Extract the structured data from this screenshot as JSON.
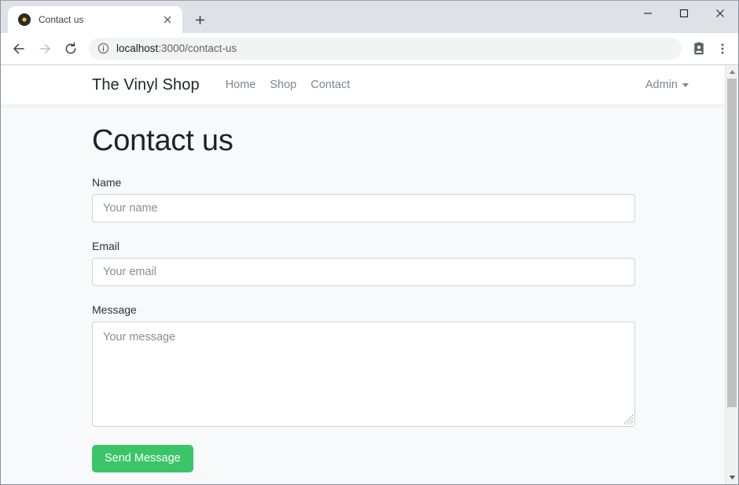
{
  "browser": {
    "tab": {
      "title": "Contact us",
      "favicon": "vinyl-record-icon",
      "close_icon": "close-icon"
    },
    "new_tab_icon": "plus-icon",
    "window_controls": {
      "minimize": "minimize-icon",
      "maximize": "maximize-icon",
      "close": "close-icon"
    },
    "toolbar": {
      "back_icon": "back-arrow-icon",
      "forward_icon": "forward-arrow-icon",
      "reload_icon": "reload-icon",
      "site_info_icon": "info-circle-icon",
      "url_host": "localhost",
      "url_path": ":3000/contact-us",
      "url_full": "localhost:3000/contact-us",
      "profile_icon": "account-card-icon",
      "menu_icon": "three-dot-menu-icon"
    },
    "scrollbar": {
      "up_icon": "scroll-up-arrow-icon",
      "down_icon": "scroll-down-arrow-icon"
    }
  },
  "site": {
    "brand": "The Vinyl Shop",
    "nav_links": [
      {
        "label": "Home"
      },
      {
        "label": "Shop"
      },
      {
        "label": "Contact"
      }
    ],
    "account": {
      "label": "Admin",
      "caret_icon": "chevron-down-icon"
    }
  },
  "main": {
    "page_title": "Contact us",
    "form": {
      "fields": [
        {
          "label": "Name",
          "placeholder": "Your name",
          "value": ""
        },
        {
          "label": "Email",
          "placeholder": "Your email",
          "value": ""
        },
        {
          "label": "Message",
          "placeholder": "Your message",
          "value": ""
        }
      ],
      "submit_label": "Send Message"
    }
  },
  "colors": {
    "accent_green": "#3ac569",
    "page_background": "#f8f9fb",
    "navbar_background": "#ffffff",
    "text_dark": "#212529",
    "text_muted": "#7b8894",
    "input_border": "#ced4da"
  }
}
